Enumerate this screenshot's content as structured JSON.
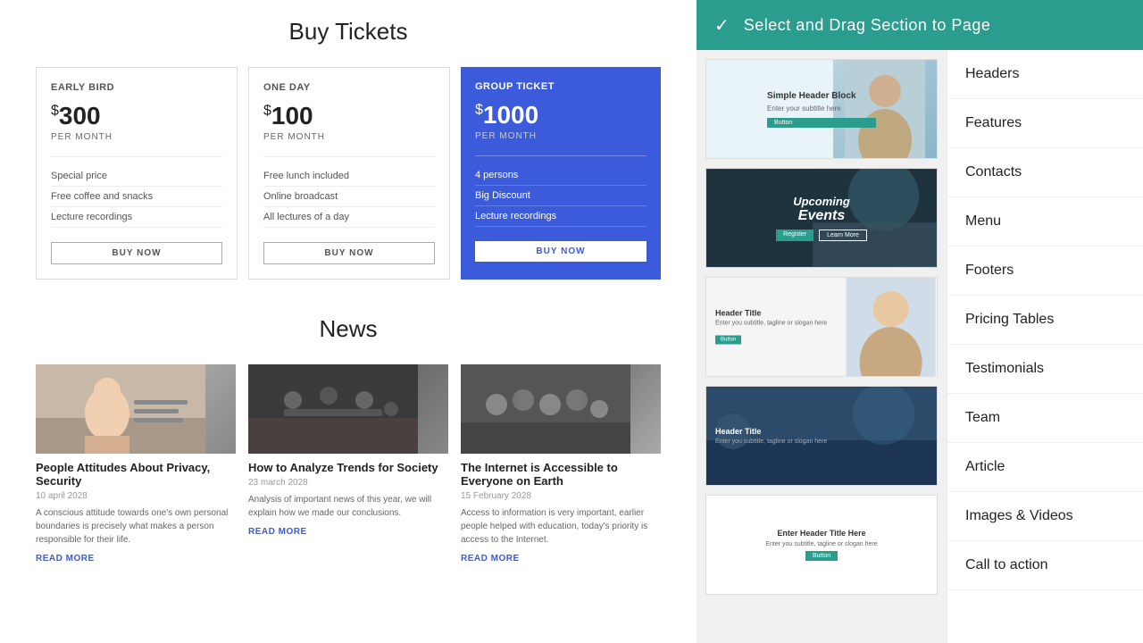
{
  "topbar": {
    "title": "Select and  Drag Section to  Page",
    "check": "✓"
  },
  "main": {
    "pricing_title": "Buy Tickets",
    "plans": [
      {
        "label": "EARLY BIRD",
        "price": "300",
        "currency": "$",
        "period": "PER MONTH",
        "features": [
          "Special price",
          "Free coffee and snacks",
          "Lecture recordings"
        ],
        "btn": "BUY NOW",
        "featured": false
      },
      {
        "label": "ONE DAY",
        "price": "100",
        "currency": "$",
        "period": "PER MONTH",
        "features": [
          "Free lunch included",
          "Online broadcast",
          "All lectures of a day"
        ],
        "btn": "BUY NOW",
        "featured": false
      },
      {
        "label": "GROUP TICKET",
        "price": "1000",
        "currency": "$",
        "period": "PER MONTH",
        "features": [
          "4 persons",
          "Big Discount",
          "Lecture recordings"
        ],
        "btn": "BUY NOW",
        "featured": true
      }
    ],
    "news_title": "News",
    "news": [
      {
        "title": "People Attitudes About Privacy, Security",
        "date": "10 april 2028",
        "desc": "A conscious attitude towards one's own personal boundaries is precisely what makes a person responsible for their life.",
        "read_more": "READ MORE"
      },
      {
        "title": "How to Analyze Trends for Society",
        "date": "23 march 2028",
        "desc": "Analysis of important news of this year, we will explain how we made our conclusions.",
        "read_more": "READ MORE"
      },
      {
        "title": "The Internet is Accessible to Everyone on Earth",
        "date": "15 February 2028",
        "desc": "Access to information is very important, earlier people helped with education, today's priority is access to the Internet.",
        "read_more": "READ MORE"
      }
    ]
  },
  "panel": {
    "thumbnails": [
      {
        "id": "thumb1",
        "type": "simple-header",
        "title": "Simple Header Block",
        "subtitle": "Enter your subtitle here",
        "btn": "Button"
      },
      {
        "id": "thumb2",
        "type": "upcoming-events",
        "title": "Upcoming",
        "subtitle": "Events"
      },
      {
        "id": "thumb3",
        "type": "header-person",
        "title": "Header Title",
        "subtitle": "Enter you subtitle, tagline or slogan here",
        "btn": "Button"
      },
      {
        "id": "thumb4",
        "type": "team-dark",
        "title": "Header Title",
        "subtitle": "Enter you subtitle, tagline or slogan here"
      },
      {
        "id": "thumb5",
        "type": "simple-white",
        "title": "Enter Header Title Here",
        "subtitle": "Enter you subtitle, tagline or slogan here",
        "btn": "Button"
      }
    ],
    "nav_items": [
      {
        "id": "headers",
        "label": "Headers"
      },
      {
        "id": "features",
        "label": "Features"
      },
      {
        "id": "contacts",
        "label": "Contacts"
      },
      {
        "id": "menu",
        "label": "Menu"
      },
      {
        "id": "footers",
        "label": "Footers"
      },
      {
        "id": "pricing-tables",
        "label": "Pricing Tables"
      },
      {
        "id": "testimonials",
        "label": "Testimonials"
      },
      {
        "id": "team",
        "label": "Team"
      },
      {
        "id": "article",
        "label": "Article"
      },
      {
        "id": "images-videos",
        "label": "Images & Videos"
      },
      {
        "id": "call-to-action",
        "label": "Call to action"
      }
    ]
  }
}
